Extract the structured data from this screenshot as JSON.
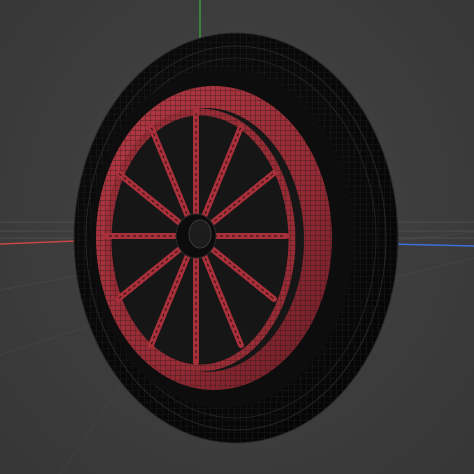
{
  "viewport": {
    "background": "#3d3d3d",
    "grid_color": "#505050",
    "axis_colors": {
      "x": "#c84646",
      "y": "#3aa040",
      "z": "#3c70d8"
    }
  },
  "model": {
    "name": "wagon-wheel",
    "display_mode": "wireframe-on-shaded",
    "tire_color": "#0a0a0a",
    "rim_color": "#a8303a",
    "wire_color": "#222222",
    "spoke_count": 12
  }
}
